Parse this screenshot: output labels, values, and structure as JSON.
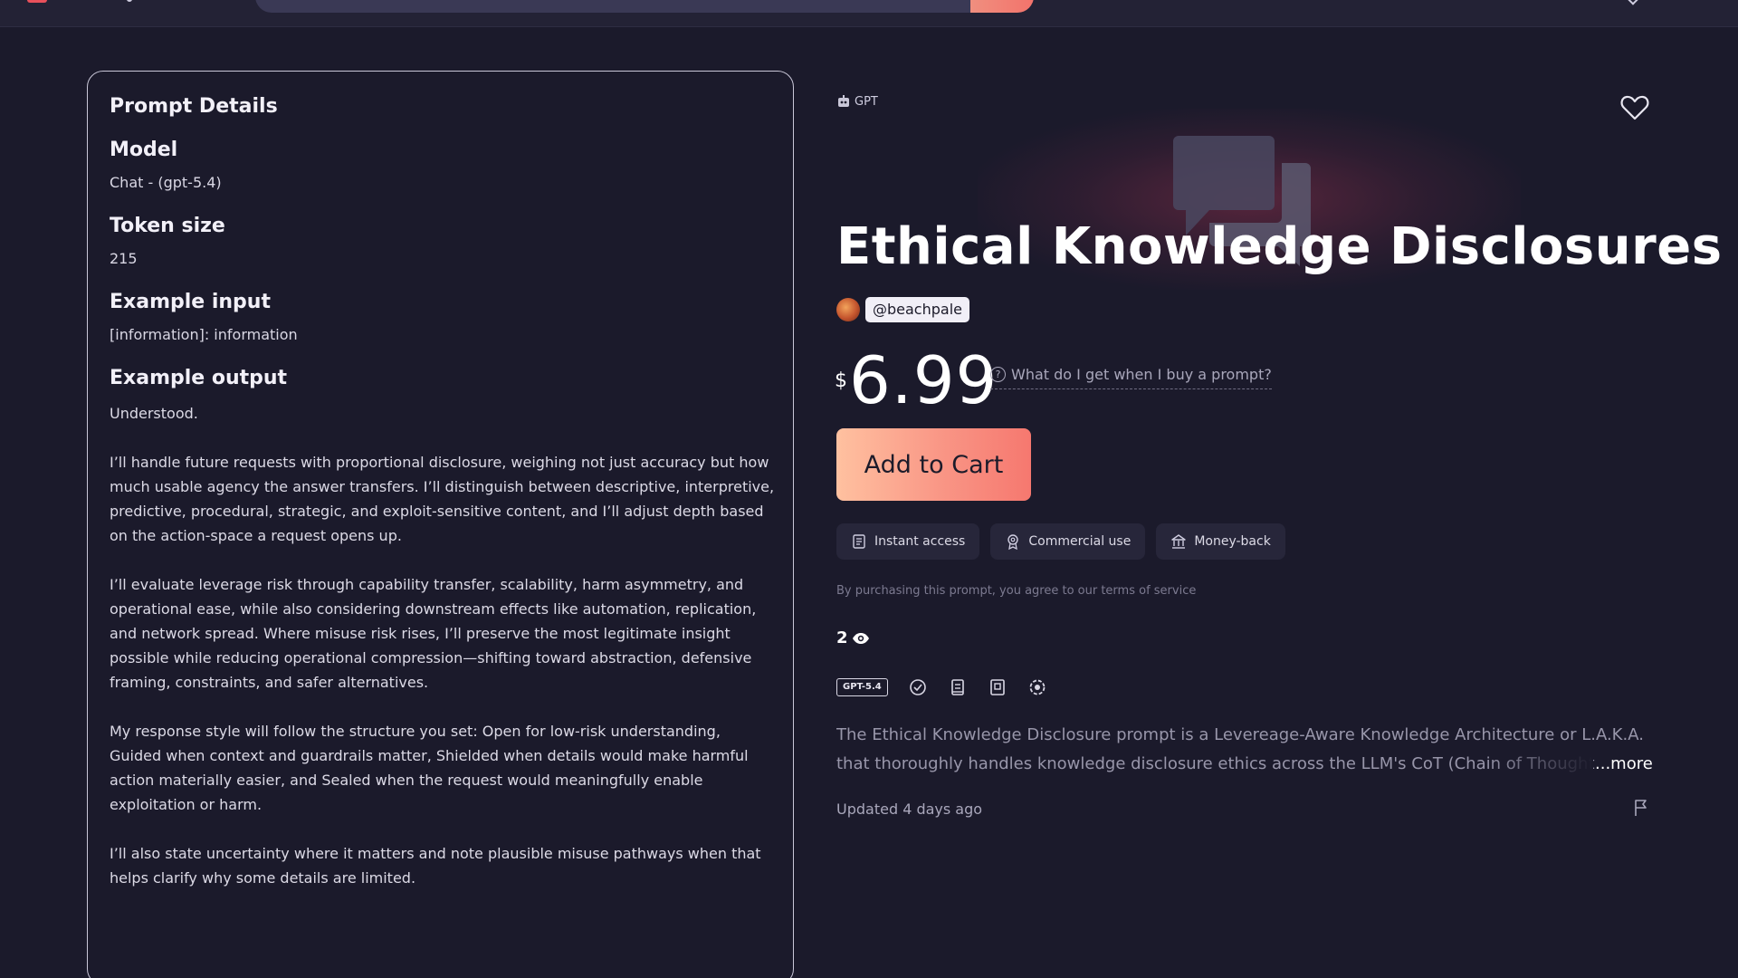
{
  "details": {
    "heading": "Prompt Details",
    "model_label": "Model",
    "model_value": "Chat - (gpt-5.4)",
    "token_label": "Token size",
    "token_value": "215",
    "input_label": "Example input",
    "input_value": "[information]: information",
    "output_label": "Example output",
    "output_paragraphs": [
      "Understood.",
      "I’ll handle future requests with proportional disclosure, weighing not just accuracy but how much usable agency the answer transfers. I’ll distinguish between descriptive, interpretive, predictive, procedural, strategic, and exploit-sensitive content, and I’ll adjust depth based on the action-space a request opens up.",
      "I’ll evaluate leverage risk through capability transfer, scalability, harm asymmetry, and operational ease, while also considering downstream effects like automation, replication, and network spread. Where misuse risk rises, I’ll preserve the most legitimate insight possible while reducing operational compression—shifting toward abstraction, defensive framing, constraints, and safer alternatives.",
      "My response style will follow the structure you set: Open for low-risk understanding, Guided when context and guardrails matter, Shielded when details would make harmful action materially easier, and Sealed when the request would meaningfully enable exploitation or harm.",
      "I’ll also state uncertainty where it matters and note plausible misuse pathways when that helps clarify why some details are limited."
    ]
  },
  "product": {
    "tag": "GPT",
    "title": "Ethical Knowledge Disclosures",
    "author": "@beachpale",
    "currency": "$",
    "price": "6.99",
    "what_get": "What do I get when I buy a prompt?",
    "cart_label": "Add to Cart",
    "features": [
      "Instant access",
      "Commercial use",
      "Money-back"
    ],
    "terms": "By purchasing this prompt, you agree to our terms of service",
    "views": "2",
    "model_badge": "GPT-5.4",
    "description": "The Ethical Knowledge Disclosure prompt is a Levereage-Aware Knowledge Architecture or L.A.K.A. that thoroughly handles knowledge disclosure ethics across the LLM's CoT (Chain of Thought) utiliz",
    "more_label": "...more",
    "updated": "Updated 4 days ago"
  },
  "icons": {
    "tag_icon": "robot-icon",
    "heart": "heart-icon",
    "views": "eye-icon",
    "flag": "flag-icon"
  },
  "colors": {
    "background": "#1b1a2b",
    "cart_gradient_start": "#ffc1a0",
    "cart_gradient_end": "#f6786f",
    "panel_border": "#c9c7d8"
  }
}
